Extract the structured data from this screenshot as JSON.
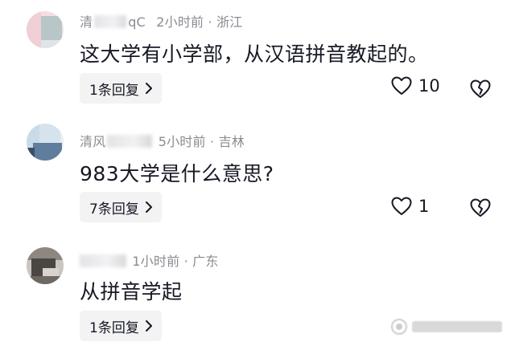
{
  "comments": [
    {
      "username_visible": "清",
      "username_tail": "qC",
      "time": "2小时前",
      "location": "浙江",
      "text": "这大学有小学部，从汉语拼音教起的。",
      "reply_label": "1条回复",
      "likes": "10",
      "avatar_colors": [
        "#f0cfd6",
        "#b9c6c8"
      ]
    },
    {
      "username_visible": "清风",
      "username_tail": "",
      "time": "5小时前",
      "location": "吉林",
      "text": "983大学是什么意思?",
      "reply_label": "7条回复",
      "likes": "1",
      "avatar_colors": [
        "#c9dbe8",
        "#5f7d9c"
      ]
    },
    {
      "username_visible": "",
      "username_tail": "",
      "time": "1小时前",
      "location": "广东",
      "text": "从拼音学起",
      "reply_label": "1条回复",
      "likes": "",
      "avatar_colors": [
        "#d7d3cf",
        "#4a4642"
      ]
    }
  ],
  "icons": {
    "like": "heart-outline-icon",
    "dislike": "broken-heart-icon",
    "reply_chevron": "chevron-right-icon"
  }
}
